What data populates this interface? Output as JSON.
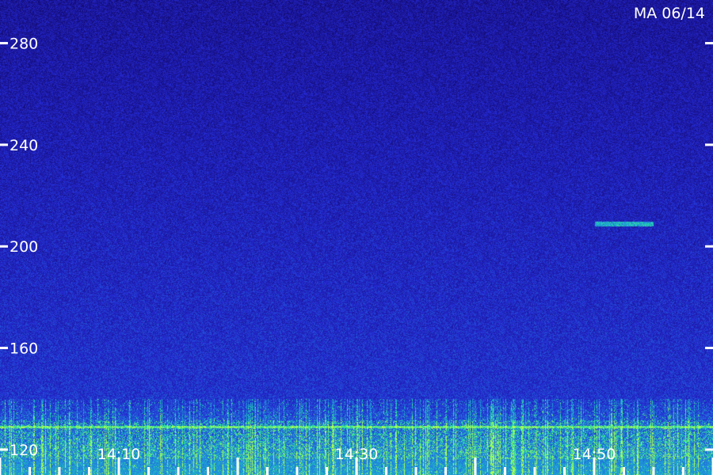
{
  "station_label": "MA 06/14",
  "chart_data": {
    "type": "heatmap",
    "title": "",
    "xlabel": "",
    "ylabel": "",
    "ylim": [
      110,
      297
    ],
    "xlim_minutes": [
      0,
      60
    ],
    "y_ticks": [
      "280",
      "240",
      "200",
      "160",
      "120"
    ],
    "y_tick_values": [
      280,
      240,
      200,
      160,
      120
    ],
    "x_tick_labels": [
      "14:10",
      "14:30",
      "14:50"
    ],
    "x_tick_minutes": [
      10,
      30,
      50
    ],
    "colormap": [
      "#12086a",
      "#2428d0",
      "#1f8fe0",
      "#22e0a0",
      "#b0ff50"
    ],
    "features": [
      {
        "kind": "horizontal-band",
        "freq": 129,
        "intensity": 0.9
      },
      {
        "kind": "broadband-noise",
        "freq_min": 110,
        "freq_max": 140,
        "intensity": 0.7
      },
      {
        "kind": "transient",
        "freq": 209,
        "minute_start": 50,
        "minute_end": 55,
        "intensity": 1.0
      }
    ]
  }
}
